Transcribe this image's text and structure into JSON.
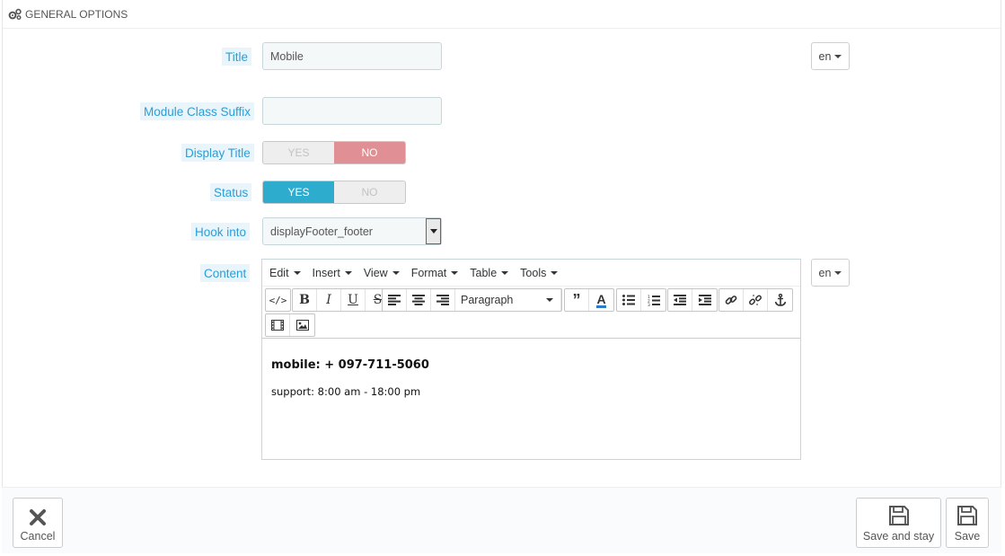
{
  "section": {
    "title": "General Options",
    "icon": "gears-icon"
  },
  "form": {
    "title": {
      "label": "Title",
      "value": "Mobile",
      "lang": "en"
    },
    "module_class_suffix": {
      "label": "Module Class Suffix",
      "value": ""
    },
    "display_title": {
      "label": "Display Title",
      "yes": "YES",
      "no": "NO",
      "selected": "NO"
    },
    "status": {
      "label": "Status",
      "yes": "YES",
      "no": "NO",
      "selected": "YES"
    },
    "hook_into": {
      "label": "Hook into",
      "value": "displayFooter_footer"
    },
    "content": {
      "label": "Content",
      "lang": "en",
      "menu": [
        "Edit",
        "Insert",
        "View",
        "Format",
        "Table",
        "Tools"
      ],
      "format_select": "Paragraph",
      "body_line1": "mobile: + 097-711-5060",
      "body_line2": "support: 8:00 am - 18:00 pm"
    }
  },
  "footer": {
    "cancel": "Cancel",
    "save_and_stay": "Save and stay",
    "save": "Save"
  },
  "colors": {
    "label_text": "#2a9ed6",
    "switch_no_active": "#e08f95",
    "switch_yes_active": "#2eacce"
  }
}
